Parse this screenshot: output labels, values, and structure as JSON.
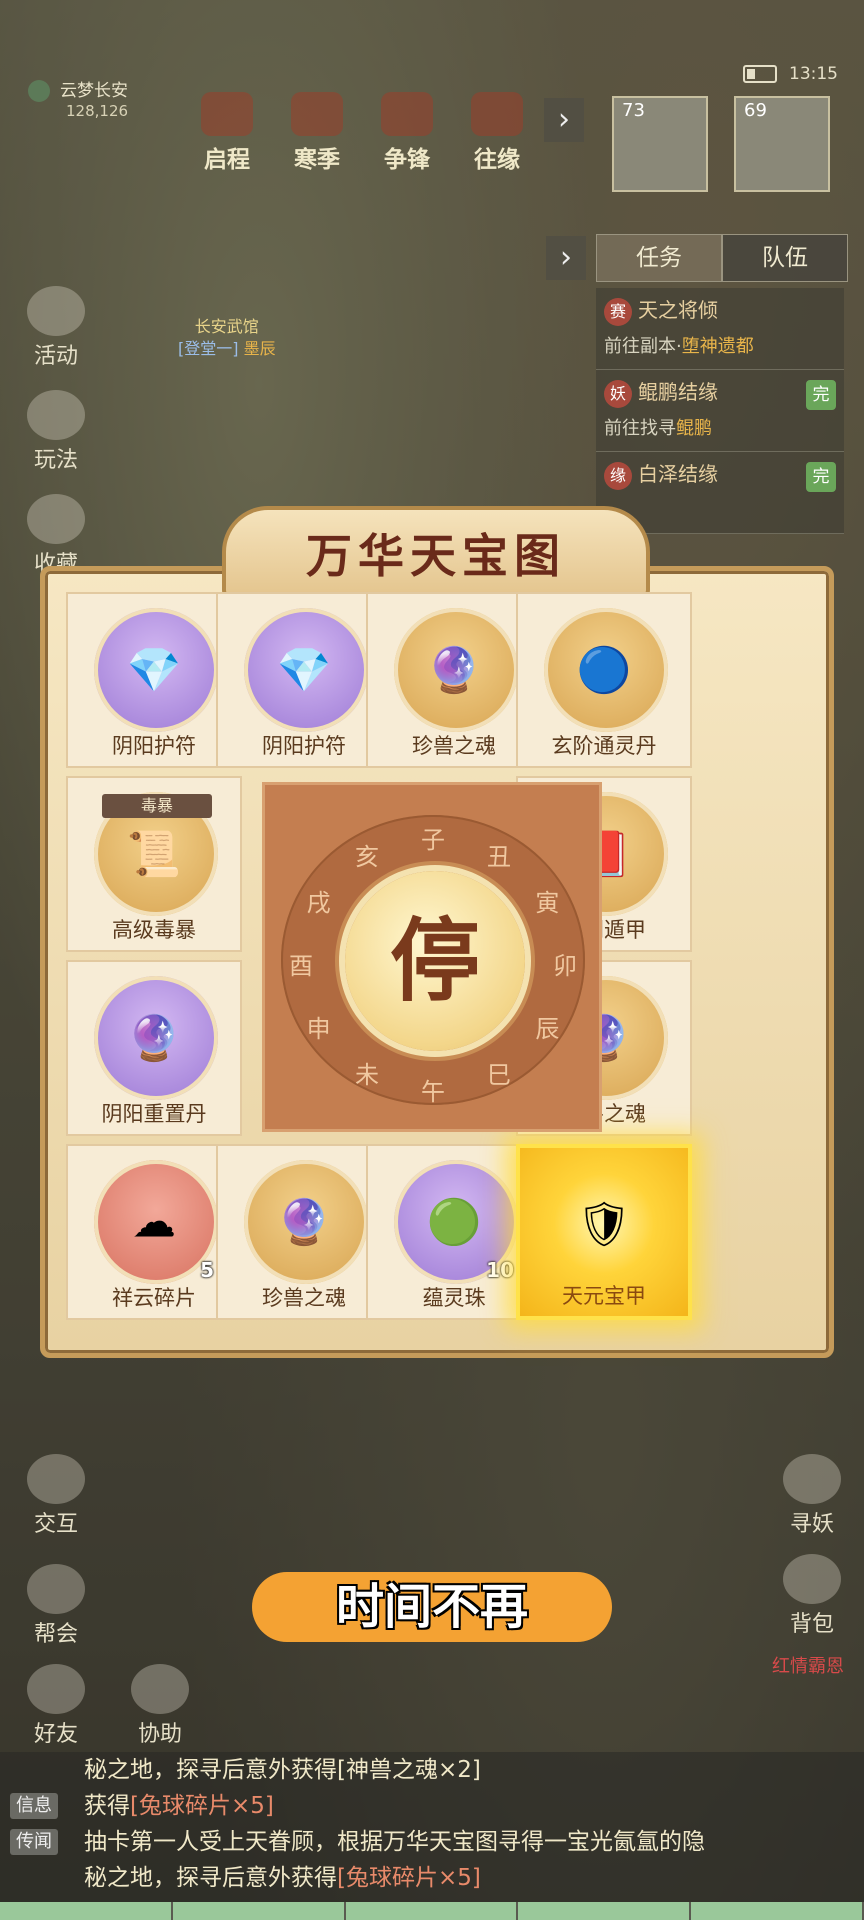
{
  "hud": {
    "location": "云梦长安",
    "coords": "128,126",
    "time": "13:15"
  },
  "top_menu": [
    "启程",
    "寒季",
    "争锋",
    "往缘"
  ],
  "portraits": [
    {
      "level": "73"
    },
    {
      "level": "69"
    }
  ],
  "task_tabs": {
    "task": "任务",
    "team": "队伍"
  },
  "quests": [
    {
      "badge": "赛",
      "title": "天之将倾",
      "sub_prefix": "前往副本·",
      "sub_target": "堕神遗都",
      "done": ""
    },
    {
      "badge": "妖",
      "title": "鲲鹏结缘",
      "sub_prefix": "前往找寻",
      "sub_target": "鲲鹏",
      "done": "完"
    },
    {
      "badge": "缘",
      "title": "白泽结缘",
      "sub_prefix": "",
      "sub_target": "",
      "done": "完"
    }
  ],
  "left_menu": [
    "活动",
    "玩法",
    "收藏"
  ],
  "npc": {
    "name": "长安武馆",
    "tag": "[登堂一]",
    "tag2": "墨辰"
  },
  "board": {
    "title": "万华天宝图",
    "center_button": "停",
    "zodiac": [
      "子",
      "丑",
      "寅",
      "卯",
      "辰",
      "巳",
      "午",
      "未",
      "申",
      "酉",
      "戌",
      "亥"
    ],
    "cells": [
      {
        "label": "阴阳护符",
        "icon": "amulet-icon",
        "bg": "purple",
        "qty": "",
        "tag": "",
        "glyph": "💎"
      },
      {
        "label": "阴阳护符",
        "icon": "amulet-icon",
        "bg": "purple",
        "qty": "",
        "tag": "",
        "glyph": "💎"
      },
      {
        "label": "珍兽之魂",
        "icon": "purple-orb-icon",
        "bg": "gold",
        "qty": "",
        "tag": "",
        "glyph": "🔮"
      },
      {
        "label": "玄阶通灵丹",
        "icon": "spirit-pill-icon",
        "bg": "gold",
        "qty": "",
        "tag": "",
        "glyph": "🔵"
      },
      {
        "label": "高级毒暴",
        "icon": "scroll-icon",
        "bg": "gold",
        "qty": "",
        "tag": "毒暴",
        "glyph": "📜"
      },
      {
        "label": "奇门遁甲",
        "icon": "red-book-icon",
        "bg": "gold",
        "qty": "",
        "tag": "",
        "glyph": "📕"
      },
      {
        "label": "阴阳重置丹",
        "icon": "crystal-ball-icon",
        "bg": "purple",
        "qty": "",
        "tag": "",
        "glyph": "🔮"
      },
      {
        "label": "珍兽之魂",
        "icon": "purple-orb-icon",
        "bg": "gold",
        "qty": "",
        "tag": "",
        "glyph": "🔮"
      },
      {
        "label": "祥云碎片",
        "icon": "cloud-puzzle-icon",
        "bg": "red",
        "qty": "5",
        "tag": "",
        "glyph": "☁"
      },
      {
        "label": "珍兽之魂",
        "icon": "purple-orb-icon",
        "bg": "gold",
        "qty": "",
        "tag": "",
        "glyph": "🔮"
      },
      {
        "label": "蕴灵珠",
        "icon": "green-pearl-icon",
        "bg": "purple",
        "qty": "10",
        "tag": "",
        "glyph": "🟢"
      },
      {
        "label": "天元宝甲",
        "icon": "armor-icon",
        "bg": "highlight",
        "qty": "",
        "tag": "",
        "glyph": "🛡"
      }
    ]
  },
  "caption": "时间不再",
  "right_menu": [
    "寻妖",
    "背包"
  ],
  "right_name": "红情霸恩",
  "bottom_left_menu": [
    "交互",
    "帮会",
    "好友",
    "协助"
  ],
  "chat": [
    {
      "kind": "",
      "text": "秘之地，探寻后意外获得[神兽之魂×2]",
      "red": ""
    },
    {
      "kind": "信息",
      "text": "获得",
      "red": "[兔球碎片×5]"
    },
    {
      "kind": "传闻",
      "text": "抽卡第一人受上天眷顾，根据万华天宝图寻得一宝光氤氲的隐",
      "red": ""
    },
    {
      "kind": "",
      "text": "秘之地，探寻后意外获得",
      "red": "[兔球碎片×5]"
    }
  ]
}
